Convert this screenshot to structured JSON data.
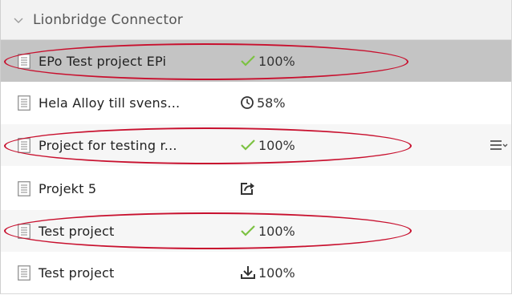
{
  "header": {
    "title": "Lionbridge Connector",
    "icon": "chevron-down-icon"
  },
  "rows": [
    {
      "name": "EPo Test project EPi",
      "status_icon": "checkmark-icon",
      "status_text": "100%",
      "selected": true,
      "highlighted": true
    },
    {
      "name": "Hela Alloy till svens...",
      "status_icon": "clock-icon",
      "status_text": "58%",
      "selected": false,
      "highlighted": false
    },
    {
      "name": "Project for testing r...",
      "status_icon": "checkmark-icon",
      "status_text": "100%",
      "selected": false,
      "highlighted": true,
      "has_context_menu": true
    },
    {
      "name": "Projekt 5",
      "status_icon": "export-icon",
      "status_text": "",
      "selected": false,
      "highlighted": false
    },
    {
      "name": "Test project",
      "status_icon": "checkmark-icon",
      "status_text": "100%",
      "selected": false,
      "highlighted": true
    },
    {
      "name": "Test project",
      "status_icon": "download-icon",
      "status_text": "100%",
      "selected": false,
      "highlighted": false
    }
  ],
  "colors": {
    "check_green": "#7cc242",
    "highlight_red": "#c8102e",
    "selected_bg": "#c4c4c4"
  }
}
